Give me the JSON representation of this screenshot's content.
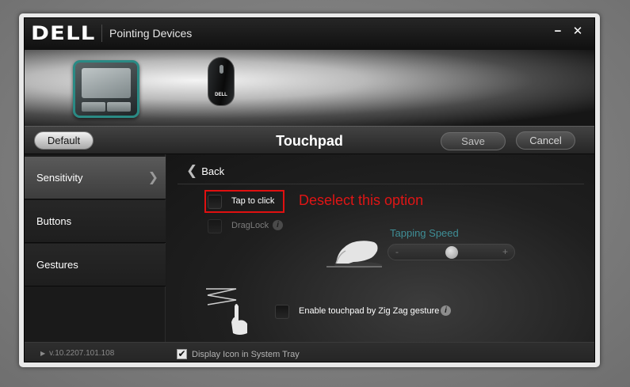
{
  "window": {
    "brand": "DELL",
    "title": "Pointing Devices",
    "minimize_glyph": "−",
    "close_glyph": "✕"
  },
  "hero": {
    "mouse_brand": "DELL"
  },
  "toolbar": {
    "default_label": "Default",
    "section_title": "Touchpad",
    "save_label": "Save",
    "cancel_label": "Cancel"
  },
  "sidebar": {
    "items": [
      {
        "label": "Sensitivity",
        "active": true
      },
      {
        "label": "Buttons",
        "active": false
      },
      {
        "label": "Gestures",
        "active": false
      }
    ]
  },
  "content": {
    "back_label": "Back",
    "tap_to_click": {
      "label": "Tap to click",
      "checked": false
    },
    "draglock": {
      "label": "DragLock",
      "checked": false,
      "enabled": false
    },
    "annotation": "Deselect this option",
    "tapping_speed": {
      "label": "Tapping Speed",
      "minus": "-",
      "plus": "+",
      "value_fraction": 0.5
    },
    "zigzag": {
      "label": "Enable touchpad by Zig Zag gesture",
      "checked": false
    }
  },
  "footer": {
    "version": "v.10.2207.101.108",
    "tray_label": "Display Icon in System Tray",
    "tray_checked": true,
    "tray_check_glyph": "✔"
  },
  "colors": {
    "annotation": "#e01515",
    "accent_label": "#3f8e96",
    "touchpad_border": "#2a8a84"
  },
  "icons": [
    "close-icon",
    "minimize-icon",
    "chevron-right-icon",
    "chevron-left-icon",
    "info-icon",
    "hand-tap-icon",
    "zigzag-gesture-icon",
    "checkmark-icon"
  ]
}
